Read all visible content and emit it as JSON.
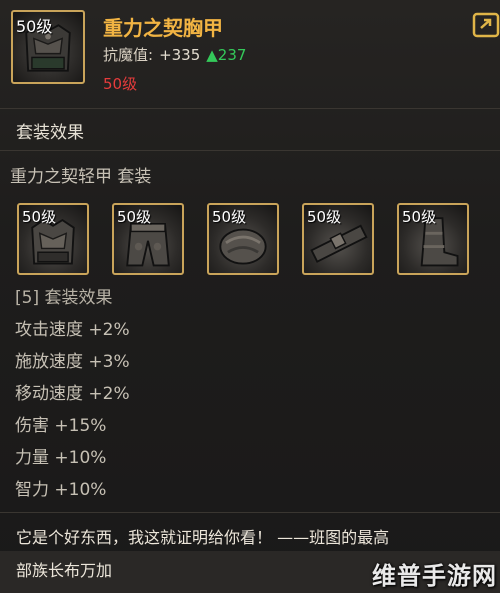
{
  "item": {
    "level_tag": "50级",
    "name": "重力之契胸甲",
    "resist_label": "抗魔值:",
    "resist_value": "+335",
    "resist_up": "▲237",
    "required_level": "50级"
  },
  "set": {
    "section_title": "套装效果",
    "set_name": "重力之契轻甲 套装",
    "pieces": [
      {
        "level_tag": "50级",
        "icon": "chest-armor-icon"
      },
      {
        "level_tag": "50级",
        "icon": "pants-armor-icon"
      },
      {
        "level_tag": "50级",
        "icon": "shoulder-armor-icon"
      },
      {
        "level_tag": "50级",
        "icon": "belt-armor-icon"
      },
      {
        "level_tag": "50级",
        "icon": "boots-armor-icon"
      }
    ],
    "effect_header": "[5] 套装效果",
    "effects": [
      "攻击速度 +2%",
      "施放速度 +3%",
      "移动速度 +2%",
      "伤害 +15%",
      "力量 +10%",
      "智力 +10%"
    ]
  },
  "flavor": {
    "line1": "它是个好东西，我这就证明给你看！ ——班图的最高",
    "line2": "部族长布万加"
  },
  "watermark": "维普手游网",
  "colors": {
    "name_gold": "#f2b443",
    "up_green": "#34c95a",
    "level_red": "#e63c3c",
    "frame_gold": "#c9a45a"
  }
}
